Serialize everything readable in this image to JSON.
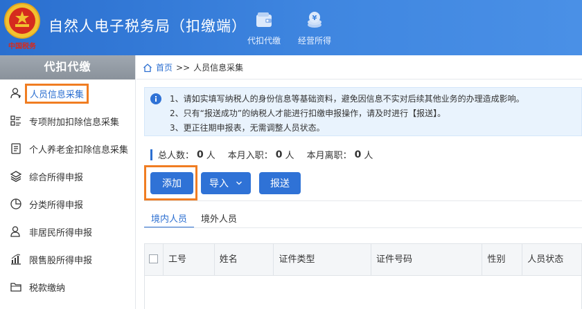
{
  "header": {
    "title": "自然人电子税务局（扣缴端）",
    "emblem_text": "中国税务",
    "nav": [
      {
        "label": "代扣代缴",
        "icon": "wallet-icon"
      },
      {
        "label": "经营所得",
        "icon": "coins-icon"
      }
    ]
  },
  "sidebar": {
    "title": "代扣代缴",
    "items": [
      {
        "label": "人员信息采集",
        "icon": "person-icon",
        "active": true
      },
      {
        "label": "专项附加扣除信息采集",
        "icon": "list-icon"
      },
      {
        "label": "个人养老金扣除信息采集",
        "icon": "document-icon"
      },
      {
        "label": "综合所得申报",
        "icon": "layers-icon"
      },
      {
        "label": "分类所得申报",
        "icon": "pie-icon"
      },
      {
        "label": "非居民所得申报",
        "icon": "user-outline-icon"
      },
      {
        "label": "限售股所得申报",
        "icon": "bar-chart-icon"
      },
      {
        "label": "税款缴纳",
        "icon": "folder-icon"
      }
    ]
  },
  "breadcrumb": {
    "home": "首页",
    "separator": ">>",
    "current": "人员信息采集"
  },
  "notice": {
    "lines": [
      "1、请如实填写纳税人的身份信息等基础资料，避免因信息不实对后续其他业务的办理造成影响。",
      "2、只有“报送成功”的纳税人才能进行扣缴申报操作，请及时进行【报送】。",
      "3、更正往期申报表，无需调整人员状态。"
    ]
  },
  "stats": {
    "total_label": "总人数：",
    "total_value": "0",
    "hired_label": "本月入职：",
    "hired_value": "0",
    "left_label": "本月离职：",
    "left_value": "0",
    "unit": "人"
  },
  "toolbar": {
    "add_label": "添加",
    "import_label": "导入",
    "report_label": "报送"
  },
  "tabs": [
    {
      "label": "境内人员",
      "active": true
    },
    {
      "label": "境外人员",
      "active": false
    }
  ],
  "table": {
    "columns": [
      "工号",
      "姓名",
      "证件类型",
      "证件号码",
      "性别",
      "人员状态"
    ]
  },
  "colors": {
    "header_blue": "#2a6fcf",
    "primary_button": "#2f72d6",
    "highlight_orange": "#f07d22",
    "link_blue": "#2c6fd1"
  }
}
